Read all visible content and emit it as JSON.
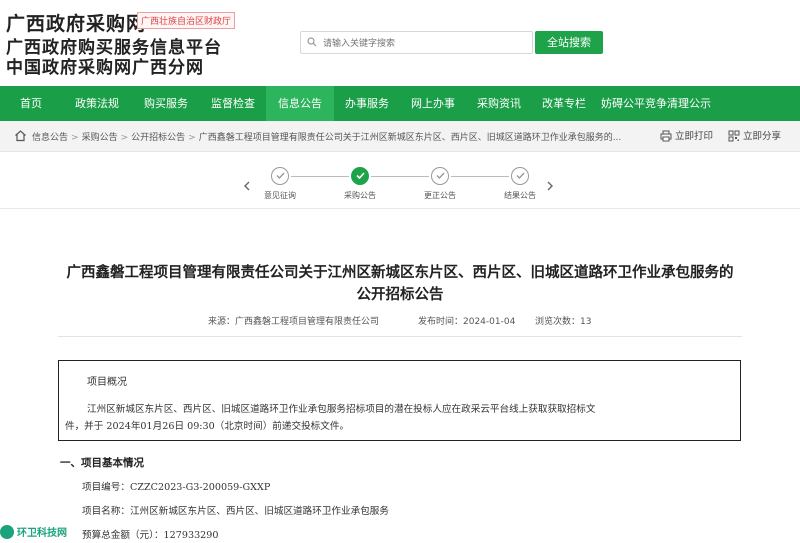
{
  "header": {
    "logo_line1": "广西政府采购网",
    "logo_badge": "广西壮族自治区财政厅",
    "logo_line2": "广西政府购买服务信息平台",
    "logo_line3": "中国政府采购网广西分网",
    "search_placeholder": "请输入关键字搜索",
    "search_button": "全站搜索"
  },
  "nav": {
    "items": [
      "首页",
      "政策法规",
      "购买服务",
      "监督检查",
      "信息公告",
      "办事服务",
      "网上办事",
      "采购资讯",
      "改革专栏",
      "妨碍公平竞争清理公示"
    ],
    "active_index": 4
  },
  "breadcrumb": {
    "items": [
      "信息公告",
      "采购公告",
      "公开招标公告",
      "广西鑫磐工程项目管理有限责任公司关于江州区新城区东片区、西片区、旧城区道路环卫作业承包服务的..."
    ],
    "separator": ">",
    "print_label": "立即打印",
    "share_label": "立即分享"
  },
  "progress": {
    "steps": [
      {
        "label": "意见征询",
        "state": "done"
      },
      {
        "label": "采购公告",
        "state": "current"
      },
      {
        "label": "更正公告",
        "state": "done"
      },
      {
        "label": "结果公告",
        "state": "done"
      }
    ]
  },
  "article": {
    "title": "广西鑫磐工程项目管理有限责任公司关于江州区新城区东片区、西片区、旧城区道路环卫作业承包服务的公开招标公告",
    "source": "来源：广西鑫磐工程项目管理有限责任公司",
    "publish_time": "发布时间：2024-01-04",
    "views": "浏览次数：13",
    "summary_heading": "项目概况",
    "summary_line1": "江州区新城区东片区、西片区、旧城区道路环卫作业承包服务招标项目的潜在投标人应在政采云平台线上获取获取招标文",
    "summary_line2": "件，并于 2024年01月26日 09:30（北京时间）前递交投标文件。",
    "section1": "一、项目基本情况",
    "project_number": "项目编号：CZZC2023-G3-200059-GXXP",
    "project_name": "项目名称：江州区新城区东片区、西片区、旧城区道路环卫作业承包服务",
    "budget": "预算总金额（元）：127933290"
  },
  "watermark": {
    "text": "环卫科技网"
  },
  "colors": {
    "primary_green": "#1a9f48",
    "active_tab": "#2db55d",
    "search_btn": "#1fa34a"
  }
}
